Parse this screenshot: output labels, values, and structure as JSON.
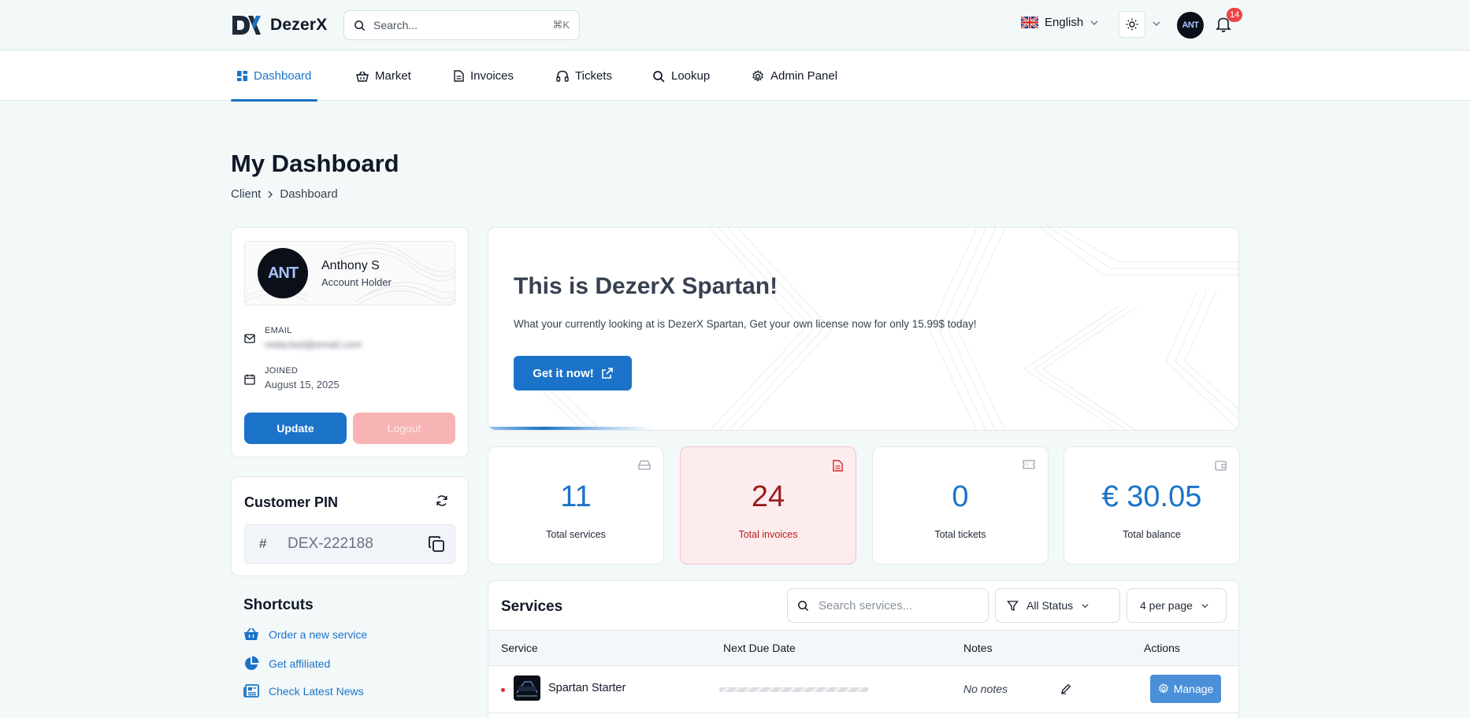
{
  "brand": {
    "name": "DezerX"
  },
  "search": {
    "placeholder": "Search...",
    "shortcut": "⌘K"
  },
  "header": {
    "language": "English",
    "avatar_initials": "ANT",
    "notifications_count": "14"
  },
  "nav": {
    "items": [
      {
        "label": "Dashboard",
        "icon": "dashboard-icon",
        "active": true
      },
      {
        "label": "Market",
        "icon": "basket-icon"
      },
      {
        "label": "Invoices",
        "icon": "document-icon"
      },
      {
        "label": "Tickets",
        "icon": "headset-icon"
      },
      {
        "label": "Lookup",
        "icon": "search-icon"
      },
      {
        "label": "Admin Panel",
        "icon": "gear-icon"
      }
    ]
  },
  "page": {
    "title": "My Dashboard",
    "breadcrumb": [
      "Client",
      "Dashboard"
    ]
  },
  "profile": {
    "avatar_initials": "ANT",
    "name": "Anthony S",
    "role": "Account Holder",
    "email_label": "EMAIL",
    "email_value": "redacted@email.com",
    "joined_label": "JOINED",
    "joined_value": "August 15, 2025",
    "update_label": "Update",
    "logout_label": "Logout"
  },
  "pin": {
    "title": "Customer PIN",
    "hash": "#",
    "value": "DEX-222188"
  },
  "shortcuts": {
    "title": "Shortcuts",
    "items": [
      {
        "label": "Order a new service",
        "icon": "basket-icon"
      },
      {
        "label": "Get affiliated",
        "icon": "pie-chart-icon"
      },
      {
        "label": "Check Latest News",
        "icon": "newspaper-icon"
      }
    ]
  },
  "banner": {
    "title": "This is DezerX Spartan!",
    "text": "What your currently looking at is DezerX Spartan, Get your own license now for only 15.99$ today!",
    "button_label": "Get it now!"
  },
  "stats": [
    {
      "value": "11",
      "label": "Total services",
      "icon": "drive-icon"
    },
    {
      "value": "24",
      "label": "Total invoices",
      "icon": "invoice-icon",
      "alert": true
    },
    {
      "value": "0",
      "label": "Total tickets",
      "icon": "ticket-icon"
    },
    {
      "value": "€ 30.05",
      "label": "Total balance",
      "icon": "wallet-icon"
    }
  ],
  "services": {
    "title": "Services",
    "search_placeholder": "Search services...",
    "filter_label": "All Status",
    "per_page_label": "4 per page",
    "columns": [
      "Service",
      "Next Due Date",
      "Notes",
      "Actions"
    ],
    "rows": [
      {
        "name": "Spartan Starter",
        "notes": "No notes",
        "action": "Manage"
      }
    ]
  },
  "colors": {
    "accent": "#1b73c9",
    "alert_bg": "#fdecee",
    "alert_text": "#9b1c1c",
    "danger": "#ef4444"
  }
}
